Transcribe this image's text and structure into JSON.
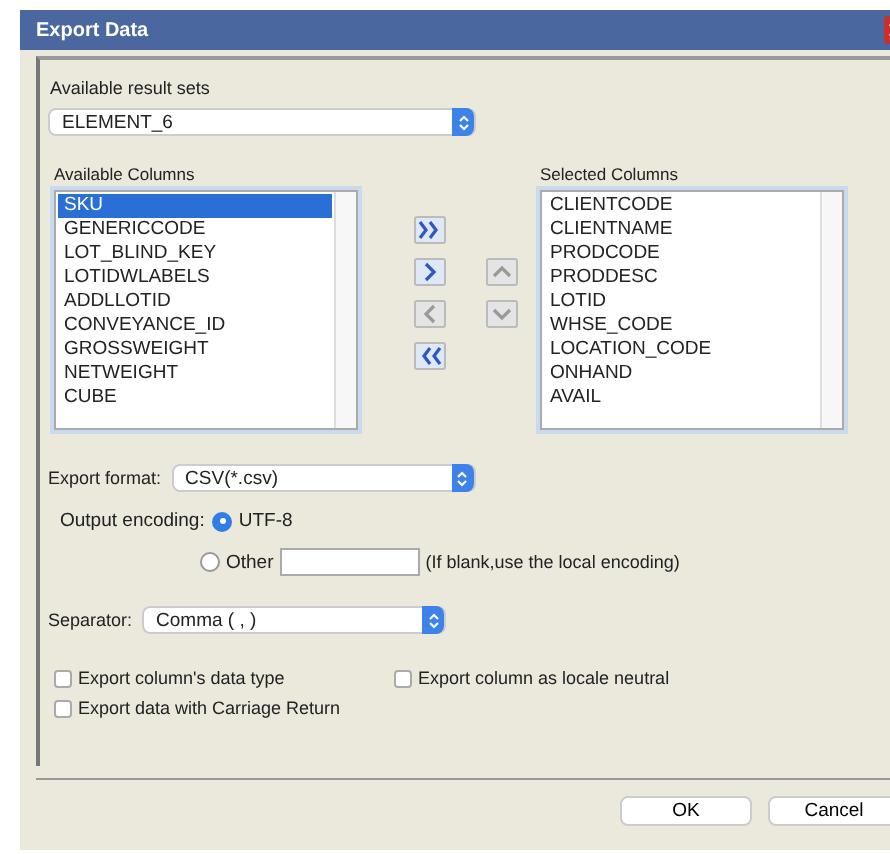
{
  "window": {
    "title": "Export Data"
  },
  "result_sets": {
    "label": "Available result sets",
    "value": "ELEMENT_6"
  },
  "available_columns": {
    "label": "Available Columns",
    "items": [
      {
        "label": "SKU",
        "selected": true
      },
      {
        "label": "GENERICCODE",
        "selected": false
      },
      {
        "label": "LOT_BLIND_KEY",
        "selected": false
      },
      {
        "label": "LOTIDWLABELS",
        "selected": false
      },
      {
        "label": "ADDLLOTID",
        "selected": false
      },
      {
        "label": "CONVEYANCE_ID",
        "selected": false
      },
      {
        "label": "GROSSWEIGHT",
        "selected": false
      },
      {
        "label": "NETWEIGHT",
        "selected": false
      },
      {
        "label": "CUBE",
        "selected": false
      }
    ]
  },
  "selected_columns": {
    "label": "Selected Columns",
    "items": [
      {
        "label": "CLIENTCODE",
        "selected": false
      },
      {
        "label": "CLIENTNAME",
        "selected": false
      },
      {
        "label": "PRODCODE",
        "selected": false
      },
      {
        "label": "PRODDESC",
        "selected": false
      },
      {
        "label": "LOTID",
        "selected": false
      },
      {
        "label": "WHSE_CODE",
        "selected": false
      },
      {
        "label": "LOCATION_CODE",
        "selected": false
      },
      {
        "label": "ONHAND",
        "selected": false
      },
      {
        "label": "AVAIL",
        "selected": false
      }
    ]
  },
  "move_buttons": [
    {
      "kind": "add_all",
      "disabled": false
    },
    {
      "kind": "add",
      "disabled": false
    },
    {
      "kind": "remove",
      "disabled": true
    },
    {
      "kind": "remove_all",
      "disabled": false
    }
  ],
  "order_buttons": [
    {
      "kind": "up",
      "disabled": true
    },
    {
      "kind": "down",
      "disabled": true
    }
  ],
  "export_format": {
    "label": "Export format:",
    "value": "CSV(*.csv)"
  },
  "output_encoding": {
    "label": "Output encoding:",
    "options": [
      {
        "label": "UTF-8",
        "selected": true
      },
      {
        "label": "Other",
        "selected": false
      }
    ],
    "hint": "(If blank,use the local encoding)"
  },
  "separator": {
    "label": "Separator:",
    "value": "Comma ( , )"
  },
  "checkboxes": [
    {
      "label": "Export column's data type",
      "checked": false
    },
    {
      "label": "Export column as locale neutral",
      "checked": false
    },
    {
      "label": "Export data with Carriage Return",
      "checked": false
    }
  ],
  "buttons": [
    "OK",
    "Cancel"
  ]
}
